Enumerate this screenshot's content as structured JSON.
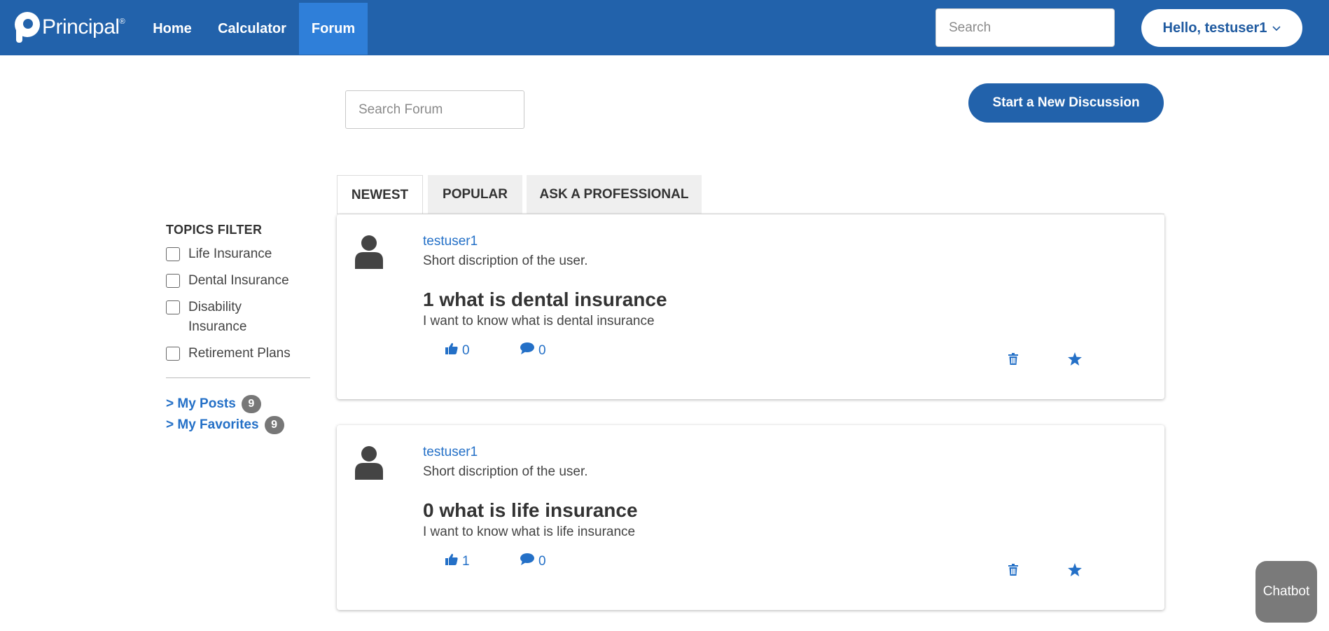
{
  "brand": {
    "name": "Principal",
    "reg": "®"
  },
  "nav": {
    "home": "Home",
    "calculator": "Calculator",
    "forum": "Forum"
  },
  "header": {
    "search_placeholder": "Search",
    "user_greeting": "Hello, testuser1"
  },
  "forum": {
    "search_placeholder": "Search Forum",
    "new_discussion": "Start a New Discussion",
    "tabs": [
      {
        "label": "NEWEST",
        "active": true
      },
      {
        "label": "POPULAR",
        "active": false
      },
      {
        "label": "ASK A PROFESSIONAL",
        "active": false
      }
    ]
  },
  "filter": {
    "title": "TOPICS FILTER",
    "items": [
      {
        "label": "Life Insurance",
        "checked": false
      },
      {
        "label": "Dental Insurance",
        "checked": false
      },
      {
        "label": "Disability Insurance",
        "checked": false
      },
      {
        "label": "Retirement Plans",
        "checked": false
      }
    ],
    "my_posts": {
      "label": "> My Posts",
      "count": "9"
    },
    "my_favorites": {
      "label": "> My Favorites",
      "count": "9"
    }
  },
  "posts": [
    {
      "user": "testuser1",
      "user_desc": "Short discription of the user.",
      "title": "1 what is dental insurance",
      "body": "I want to know what is dental insurance",
      "likes": "0",
      "comments": "0"
    },
    {
      "user": "testuser1",
      "user_desc": "Short discription of the user.",
      "title": "0 what is life insurance",
      "body": "I want to know what is life insurance",
      "likes": "1",
      "comments": "0"
    }
  ],
  "chatbot": {
    "label": "Chatbot"
  },
  "colors": {
    "primary": "#2262ab",
    "nav_active": "#2f7fd9",
    "link": "#2470c7",
    "badge": "#777777",
    "chatbot": "#7a7a7a"
  },
  "icons": [
    "principal-logo",
    "chevron-down-icon",
    "user-avatar-icon",
    "thumbs-up-icon",
    "comment-icon",
    "trash-icon",
    "star-icon"
  ]
}
